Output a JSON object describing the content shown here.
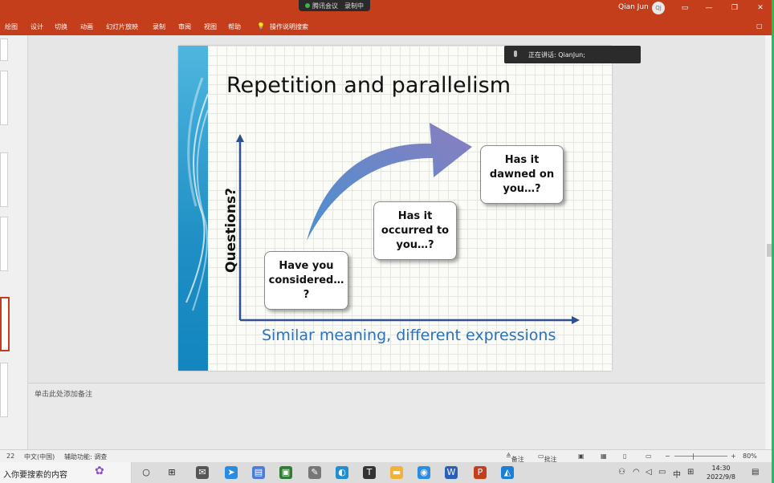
{
  "titlebar": {
    "meeting_app": "腾讯会议",
    "meeting_status": "录制中",
    "user_name": "Qian Jun",
    "avatar_initials": "QJ"
  },
  "ribbon": {
    "tabs": [
      "绘图",
      "设计",
      "切换",
      "动画",
      "幻灯片放映",
      "录制",
      "审阅",
      "视图",
      "帮助",
      "操作说明搜索"
    ]
  },
  "speaking": {
    "text": "正在讲话: QianJun;"
  },
  "slide": {
    "title": "Repetition and parallelism",
    "y_axis_label": "Questions?",
    "x_axis_label": "Similar meaning, different expressions",
    "boxes": [
      {
        "lines": [
          "Have you",
          "considered…",
          "?"
        ]
      },
      {
        "lines": [
          "Has it",
          "occurred to",
          "you…?"
        ]
      },
      {
        "lines": [
          "Has it",
          "dawned on",
          "you…?"
        ]
      }
    ],
    "colors": {
      "sidebar": "#1f8fc4",
      "axis": "#2f4f8f",
      "arrow_start": "#4a90d0",
      "arrow_end": "#8a7ec0",
      "x_label": "#2a72c0"
    }
  },
  "notes": {
    "placeholder": "单击此处添加备注"
  },
  "statusbar": {
    "slide_no": "22",
    "language": "中文(中国)",
    "accessibility": "辅助功能: 调查",
    "notes_btn": "备注",
    "comments_btn": "批注",
    "zoom": "80%"
  },
  "taskbar": {
    "search_placeholder": "入你要搜索的内容",
    "ime": "中",
    "time": "14:30",
    "date": "2022/9/8"
  }
}
